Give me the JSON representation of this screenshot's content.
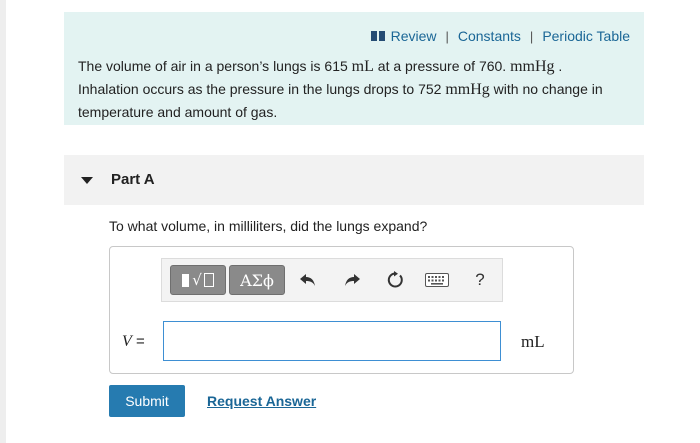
{
  "header_links": {
    "review": "Review",
    "separator": "|",
    "constants": "Constants",
    "periodic_table": "Periodic Table"
  },
  "problem": {
    "t1": "The volume of air in a person’s lungs is 615 ",
    "u1": "mL",
    "t2": " at a pressure of 760. ",
    "u2": "mmHg",
    "t3": " .",
    "t4": "Inhalation occurs as the pressure in the lungs drops to 752 ",
    "u3": "mmHg",
    "t5": " with no change in temperature and amount of gas."
  },
  "part": {
    "title": "Part A",
    "question": "To what volume, in milliliters, did the lungs expand?"
  },
  "toolbar": {
    "greek_label": "ΑΣϕ",
    "help_label": "?"
  },
  "answer": {
    "variable": "V",
    "equals": " =",
    "value": "",
    "unit": "mL"
  },
  "actions": {
    "submit": "Submit",
    "request": "Request Answer"
  },
  "colors": {
    "problem_bg": "#e3f3f2",
    "link": "#1a6696",
    "submit_bg": "#267bb0",
    "input_border": "#3e8fd3"
  },
  "icons": [
    "book-icon",
    "templates-icon",
    "undo-icon",
    "redo-icon",
    "reset-icon",
    "keyboard-icon",
    "help-icon",
    "caret-down-icon"
  ]
}
